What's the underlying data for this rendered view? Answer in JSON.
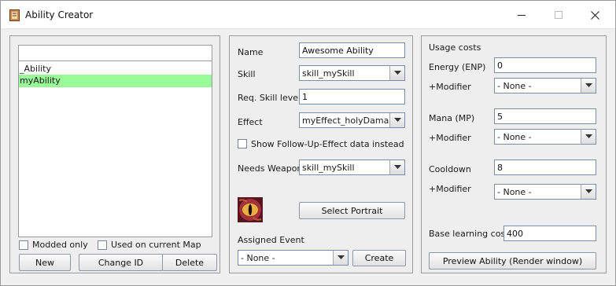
{
  "window": {
    "title": "Ability Creator",
    "controls": [
      "minimize-icon",
      "maximize-icon",
      "close-icon"
    ]
  },
  "left_panel": {
    "filter_value": "",
    "items": [
      {
        "label": "_Ability",
        "selected": false
      },
      {
        "label": "myAbility",
        "selected": true
      }
    ],
    "modded_only": "Modded only",
    "used_on_map": "Used on current Map",
    "new_button": "New",
    "change_id_button": "Change ID",
    "delete_button": "Delete",
    "selected_color": "#98fb98"
  },
  "middle_panel": {
    "name_label": "Name",
    "name_value": "Awesome Ability",
    "skill_label": "Skill",
    "skill_value": "skill_mySkill",
    "req_skill_label": "Req. Skill level",
    "req_skill_value": "1",
    "effect_label": "Effect",
    "effect_value": "myEffect_holyDamage",
    "follow_up_label": "Show Follow-Up-Effect data instead",
    "needs_weapon_label": "Needs Weapon",
    "needs_weapon_value": "skill_mySkill",
    "portrait_icon": "dragon-eye-portrait",
    "select_portrait_button": "Select Portrait",
    "assigned_event_label": "Assigned Event",
    "assigned_event_value": "- None -",
    "create_button": "Create"
  },
  "right_panel": {
    "usage_costs_label": "Usage costs",
    "energy_label": "Energy (ENP)",
    "energy_value": "0",
    "energy_modifier_label": "+Modifier",
    "energy_modifier_value": "- None -",
    "mana_label": "Mana (MP)",
    "mana_value": "5",
    "mana_modifier_label": "+Modifier",
    "mana_modifier_value": "- None -",
    "cooldown_label": "Cooldown",
    "cooldown_value": "8",
    "cooldown_modifier_label": "+Modifier",
    "cooldown_modifier_value": "- None -",
    "base_learning_label": "Base learning cost",
    "base_learning_value": "400",
    "preview_button": "Preview Ability (Render window)"
  }
}
